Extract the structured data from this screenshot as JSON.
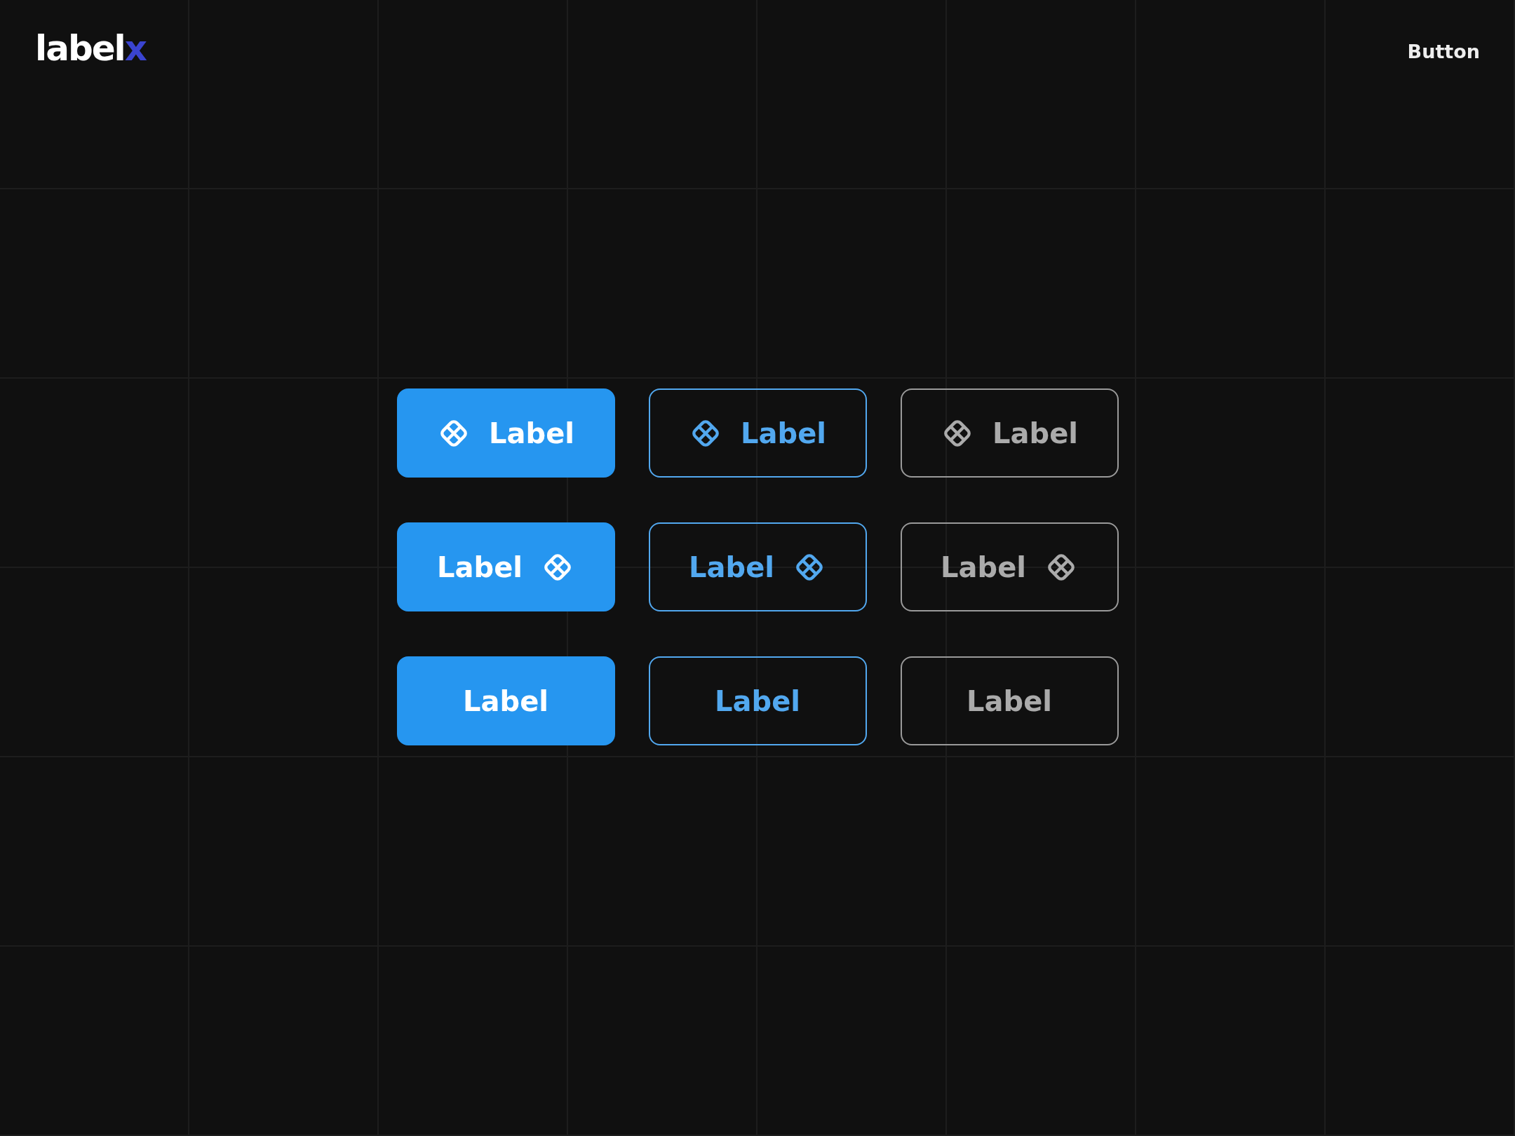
{
  "logo": {
    "text": "label",
    "accent": "x"
  },
  "page_title": "Button",
  "rows": [
    {
      "kind": "leading",
      "buttons": [
        {
          "kind": "filled",
          "label": "Label"
        },
        {
          "kind": "outline",
          "label": "Label"
        },
        {
          "kind": "ghost",
          "label": "Label"
        }
      ]
    },
    {
      "kind": "trailing",
      "buttons": [
        {
          "kind": "filled",
          "label": "Label"
        },
        {
          "kind": "outline",
          "label": "Label"
        },
        {
          "kind": "ghost",
          "label": "Label"
        }
      ]
    },
    {
      "kind": "plain",
      "buttons": [
        {
          "kind": "filled",
          "label": "Label"
        },
        {
          "kind": "outline",
          "label": "Label"
        },
        {
          "kind": "ghost",
          "label": "Label"
        }
      ]
    }
  ]
}
